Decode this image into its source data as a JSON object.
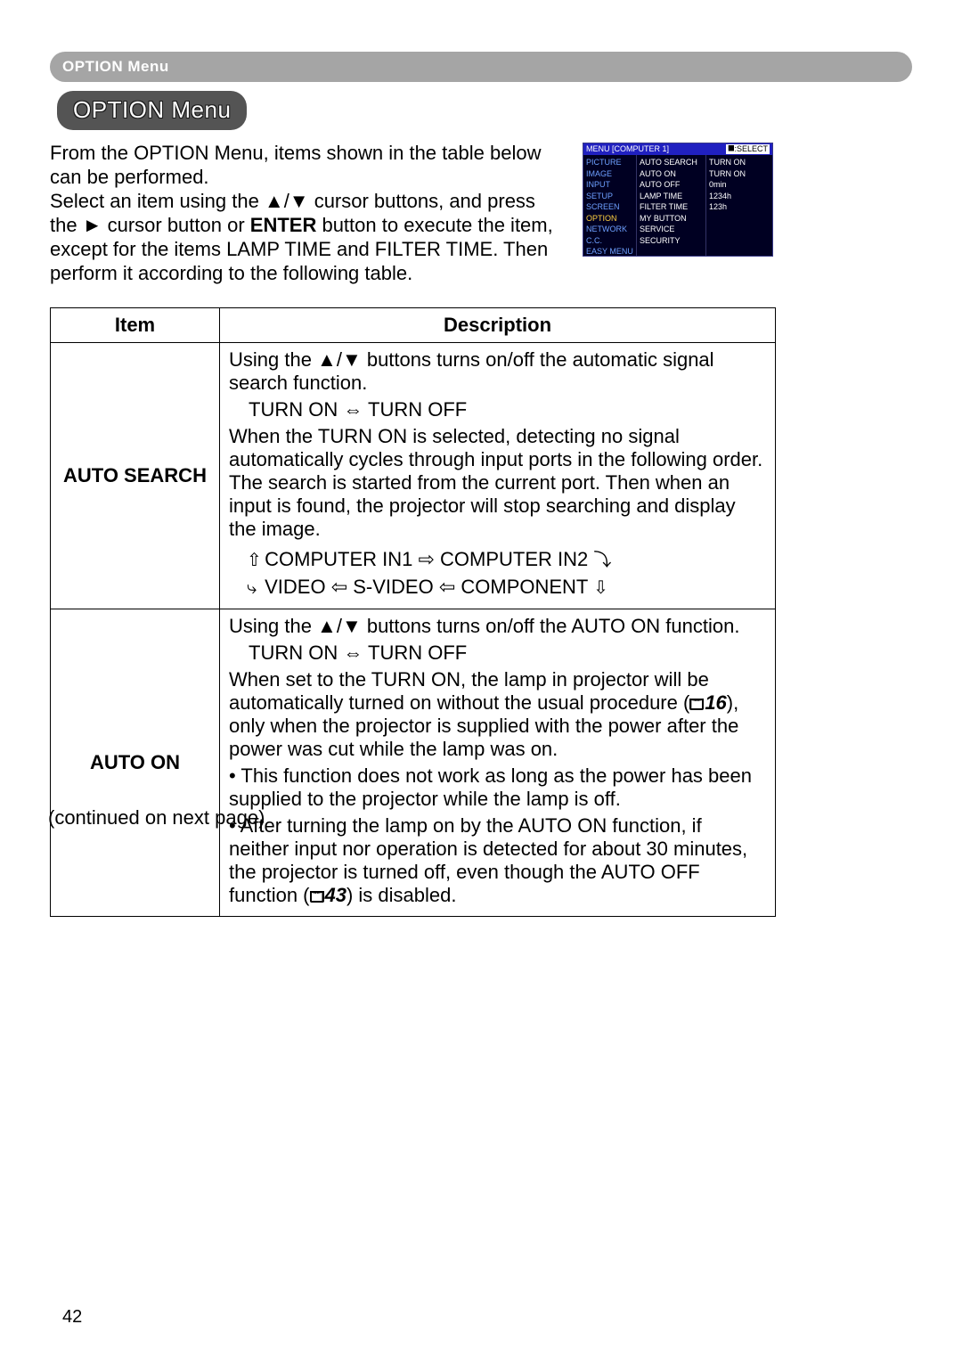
{
  "breadcrumb": "OPTION Menu",
  "title": "OPTION Menu",
  "intro": {
    "p1": "From the OPTION Menu, items shown in the table below can be performed.",
    "p2a": "Select an item using the ▲/▼ cursor buttons, and press the ► cursor button or ",
    "p2enter": "ENTER",
    "p2b": " button to execute the item, except for the items LAMP TIME and FILTER TIME. Then perform it according to the following table."
  },
  "osd": {
    "header_left": "MENU [COMPUTER 1]",
    "header_right": "⯀:SELECT",
    "col1": [
      "PICTURE",
      "IMAGE",
      "INPUT",
      "SETUP",
      "SCREEN",
      "OPTION",
      "NETWORK",
      "C.C.",
      "EASY MENU"
    ],
    "col1_selected_index": 5,
    "col2": [
      "AUTO SEARCH",
      "AUTO ON",
      "AUTO OFF",
      "LAMP TIME",
      "FILTER TIME",
      "MY BUTTON",
      "SERVICE",
      "SECURITY"
    ],
    "col3": [
      "TURN ON",
      "TURN ON",
      "0min",
      "1234h",
      "123h",
      "",
      "",
      ""
    ]
  },
  "table": {
    "head_item": "Item",
    "head_desc": "Description",
    "rows": [
      {
        "item": "AUTO SEARCH",
        "desc_line1": "Using the ▲/▼ buttons turns on/off the automatic signal search function.",
        "toggle": "TURN ON ⇔ TURN OFF",
        "desc_para": "When the TURN ON is selected, detecting no signal automatically cycles through input ports in the following order. The search is started from the current port. Then when an input is found, the projector will stop searching and display the image.",
        "flow_top": "COMPUTER IN1 ⇨ COMPUTER IN2",
        "flow_bottom": "VIDEO ⇦ S-VIDEO ⇦ COMPONENT"
      },
      {
        "item": "AUTO ON",
        "desc_line1": "Using the ▲/▼ buttons turns on/off the AUTO ON function.",
        "toggle": "TURN ON ⇔ TURN OFF",
        "p1a": "When set to the TURN ON, the lamp in projector will be automatically turned on without the usual procedure (",
        "p1ref": "16",
        "p1b": "), only when the projector is supplied with the power after the power was cut while the lamp was on.",
        "bullet1": "• This function does not work as long as the power has been supplied to the projector while the lamp is off.",
        "bullet2a": "• After turning the lamp on by the AUTO ON function, if neither input nor operation is detected for about 30 minutes, the projector is turned off, even though the AUTO OFF function (",
        "bullet2ref": "43",
        "bullet2b": ") is disabled."
      }
    ]
  },
  "continued": "(continued on next page)",
  "page_number": "42"
}
